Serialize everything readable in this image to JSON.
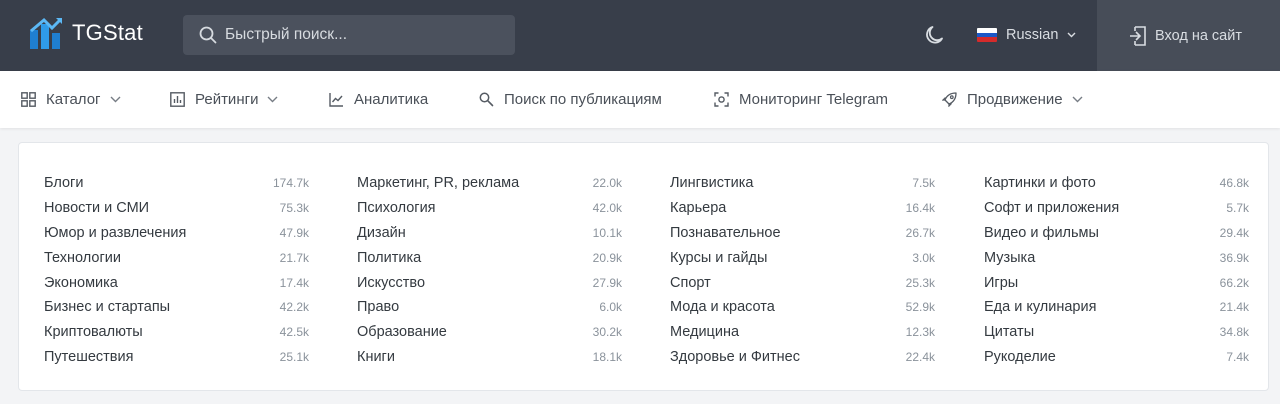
{
  "header": {
    "logo_text": "TGStat",
    "search_placeholder": "Быстрый поиск...",
    "language": "Russian",
    "login_label": "Вход на сайт"
  },
  "nav": {
    "items": [
      {
        "label": "Каталог",
        "icon": "grid-icon",
        "dropdown": true
      },
      {
        "label": "Рейтинги",
        "icon": "bar-chart-icon",
        "dropdown": true
      },
      {
        "label": "Аналитика",
        "icon": "line-chart-icon",
        "dropdown": false
      },
      {
        "label": "Поиск по публикациям",
        "icon": "search-icon",
        "dropdown": false
      },
      {
        "label": "Мониторинг Telegram",
        "icon": "monitor-icon",
        "dropdown": false
      },
      {
        "label": "Продвижение",
        "icon": "rocket-icon",
        "dropdown": true
      }
    ]
  },
  "categories": {
    "columns": [
      [
        {
          "name": "Блоги",
          "count": "174.7k"
        },
        {
          "name": "Новости и СМИ",
          "count": "75.3k"
        },
        {
          "name": "Юмор и развлечения",
          "count": "47.9k"
        },
        {
          "name": "Технологии",
          "count": "21.7k"
        },
        {
          "name": "Экономика",
          "count": "17.4k"
        },
        {
          "name": "Бизнес и стартапы",
          "count": "42.2k"
        },
        {
          "name": "Криптовалюты",
          "count": "42.5k"
        },
        {
          "name": "Путешествия",
          "count": "25.1k"
        }
      ],
      [
        {
          "name": "Маркетинг, PR, реклама",
          "count": "22.0k"
        },
        {
          "name": "Психология",
          "count": "42.0k"
        },
        {
          "name": "Дизайн",
          "count": "10.1k"
        },
        {
          "name": "Политика",
          "count": "20.9k"
        },
        {
          "name": "Искусство",
          "count": "27.9k"
        },
        {
          "name": "Право",
          "count": "6.0k"
        },
        {
          "name": "Образование",
          "count": "30.2k"
        },
        {
          "name": "Книги",
          "count": "18.1k"
        }
      ],
      [
        {
          "name": "Лингвистика",
          "count": "7.5k"
        },
        {
          "name": "Карьера",
          "count": "16.4k"
        },
        {
          "name": "Познавательное",
          "count": "26.7k"
        },
        {
          "name": "Курсы и гайды",
          "count": "3.0k"
        },
        {
          "name": "Спорт",
          "count": "25.3k"
        },
        {
          "name": "Мода и красота",
          "count": "52.9k"
        },
        {
          "name": "Медицина",
          "count": "12.3k"
        },
        {
          "name": "Здоровье и Фитнес",
          "count": "22.4k"
        }
      ],
      [
        {
          "name": "Картинки и фото",
          "count": "46.8k"
        },
        {
          "name": "Софт и приложения",
          "count": "5.7k"
        },
        {
          "name": "Видео и фильмы",
          "count": "29.4k"
        },
        {
          "name": "Музыка",
          "count": "36.9k"
        },
        {
          "name": "Игры",
          "count": "66.2k"
        },
        {
          "name": "Еда и кулинария",
          "count": "21.4k"
        },
        {
          "name": "Цитаты",
          "count": "34.8k"
        },
        {
          "name": "Рукоделие",
          "count": "7.4k"
        }
      ]
    ]
  },
  "colors": {
    "header_bg": "#383e4a",
    "search_bg": "#4b515d",
    "login_bg": "#474d58",
    "logo_blue": "#2f9be9",
    "page_bg": "#f3f4f6"
  }
}
